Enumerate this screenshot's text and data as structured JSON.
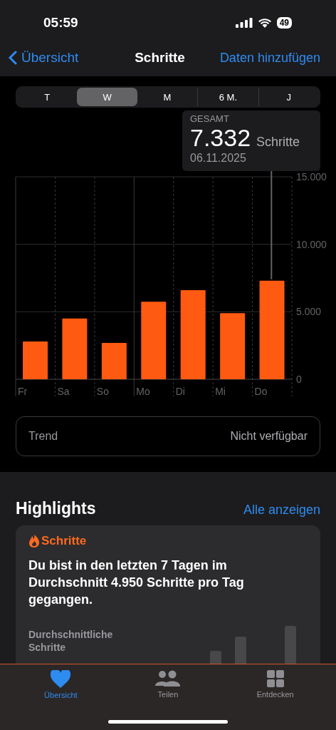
{
  "status_bar": {
    "time": "05:59",
    "battery": "49"
  },
  "nav": {
    "back": "Übersicht",
    "title": "Schritte",
    "action": "Daten hinzufügen"
  },
  "segments": [
    {
      "label": "T",
      "selected": false
    },
    {
      "label": "W",
      "selected": true
    },
    {
      "label": "M",
      "selected": false
    },
    {
      "label": "6 M.",
      "selected": false
    },
    {
      "label": "J",
      "selected": false
    }
  ],
  "tooltip": {
    "label": "GESAMT",
    "value": "7.332",
    "unit": "Schritte",
    "date": "06.11.2025"
  },
  "chart_data": {
    "type": "bar",
    "categories": [
      "Fr",
      "Sa",
      "So",
      "Mo",
      "Di",
      "Mi",
      "Do"
    ],
    "series": [
      {
        "color": "#ff5a12",
        "values": [
          2800,
          4500,
          2700,
          5750,
          6600,
          4900,
          7300
        ]
      }
    ],
    "ref_lines": [
      {
        "axis": "x",
        "value": "Mo"
      }
    ],
    "ylim": [
      0,
      15000
    ],
    "yticks": [
      {
        "value": 0,
        "label": "0"
      },
      {
        "value": 5000,
        "label": "5.000"
      },
      {
        "value": 10000,
        "label": "10.000"
      },
      {
        "value": 15000,
        "label": "15.000"
      }
    ]
  },
  "trend": {
    "label": "Trend",
    "value": "Nicht verfügbar"
  },
  "highlights": {
    "title": "Highlights",
    "link": "Alle anzeigen",
    "card": {
      "category": "Schritte",
      "text": "Du bist in den letzten 7 Tagen im Durchschnitt 4.950 Schritte pro Tag gegangen.",
      "chart_label": "Durchschnittliche Schritte"
    }
  },
  "tab_bar": [
    {
      "label": "Übersicht",
      "kind": "heart",
      "selected": true
    },
    {
      "label": "Teilen",
      "kind": "people",
      "selected": false
    },
    {
      "label": "Entdecken",
      "kind": "grid",
      "selected": false
    }
  ]
}
